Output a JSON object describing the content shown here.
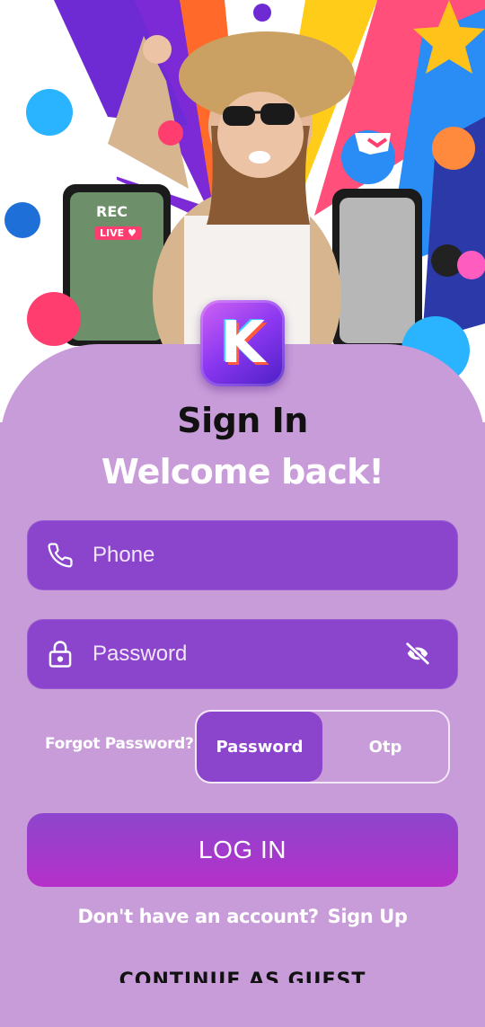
{
  "hero": {
    "rec_label": "REC",
    "live_label": "LIVE"
  },
  "logo": {
    "letter": "K"
  },
  "header": {
    "title": "Sign In",
    "subtitle": "Welcome back!"
  },
  "form": {
    "phone_placeholder": "Phone",
    "phone_value": "",
    "password_placeholder": "Password",
    "password_value": ""
  },
  "forgot_label": "Forgot Password?",
  "login_mode": {
    "options": [
      "Password",
      "Otp"
    ],
    "selected": "Password"
  },
  "login_button": "LOG IN",
  "signup": {
    "prompt": "Don't have an account?",
    "link": "Sign Up"
  },
  "guest_label": "CONTINUE AS GUEST",
  "colors": {
    "card_bg": "#c89bd9",
    "field_bg": "#8b45cc",
    "button_gradient_start": "#8d45cd",
    "button_gradient_end": "#b530c9",
    "title_text": "#111111",
    "subtitle_text": "#ffffff"
  },
  "icons": [
    "phone-icon",
    "lock-icon",
    "eye-off-icon"
  ]
}
